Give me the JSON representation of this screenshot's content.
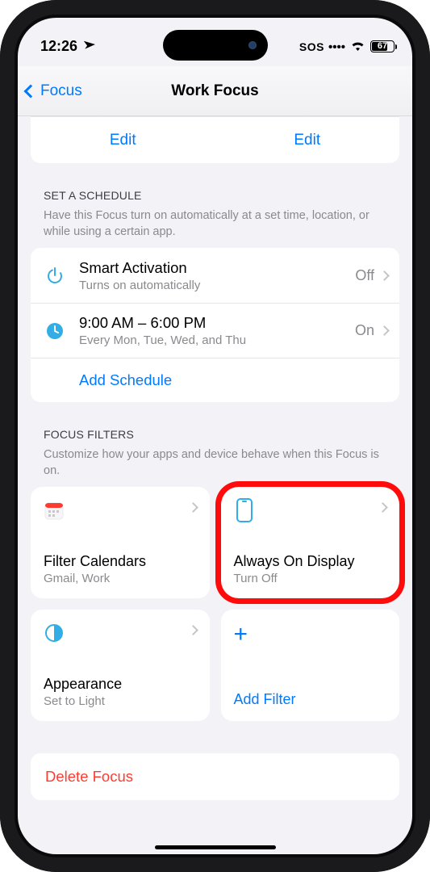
{
  "statusbar": {
    "time": "12:26",
    "sos": "SOS",
    "battery": "67"
  },
  "nav": {
    "back_label": "Focus",
    "title": "Work Focus"
  },
  "edit_row": {
    "left": "Edit",
    "right": "Edit"
  },
  "schedule": {
    "header": "SET A SCHEDULE",
    "desc": "Have this Focus turn on automatically at a set time, location, or while using a certain app.",
    "items": [
      {
        "title": "Smart Activation",
        "sub": "Turns on automatically",
        "value": "Off",
        "icon": "power"
      },
      {
        "title": "9:00 AM – 6:00 PM",
        "sub": "Every Mon, Tue, Wed, and Thu",
        "value": "On",
        "icon": "clock"
      }
    ],
    "add": "Add Schedule"
  },
  "filters": {
    "header": "FOCUS FILTERS",
    "desc": "Customize how your apps and device behave when this Focus is on.",
    "cards": [
      {
        "title": "Filter Calendars",
        "sub": "Gmail, Work",
        "icon": "calendar"
      },
      {
        "title": "Always On Display",
        "sub": "Turn Off",
        "icon": "phone",
        "highlighted": true
      },
      {
        "title": "Appearance",
        "sub": "Set to Light",
        "icon": "appearance"
      }
    ],
    "add": "Add Filter"
  },
  "delete": {
    "label": "Delete Focus"
  }
}
